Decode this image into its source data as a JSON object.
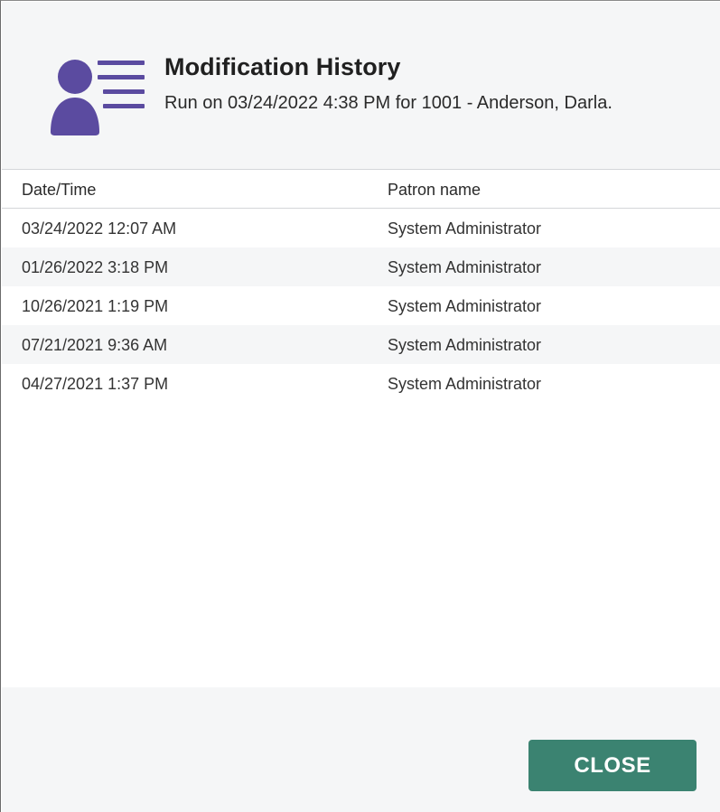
{
  "dialog": {
    "title": "Modification History",
    "subtitle": "Run on 03/24/2022 4:38 PM for 1001 - Anderson, Darla.",
    "icon": "user-list-icon",
    "accent_color": "#5b4ba0"
  },
  "table": {
    "columns": [
      "Date/Time",
      "Patron name"
    ],
    "rows": [
      [
        "03/24/2022 12:07 AM",
        "System Administrator"
      ],
      [
        "01/26/2022 3:18 PM",
        "System Administrator"
      ],
      [
        "10/26/2021 1:19 PM",
        "System Administrator"
      ],
      [
        "07/21/2021 9:36 AM",
        "System Administrator"
      ],
      [
        "04/27/2021 1:37 PM",
        "System Administrator"
      ]
    ]
  },
  "footer": {
    "close_label": "CLOSE",
    "close_color": "#3b8371"
  }
}
